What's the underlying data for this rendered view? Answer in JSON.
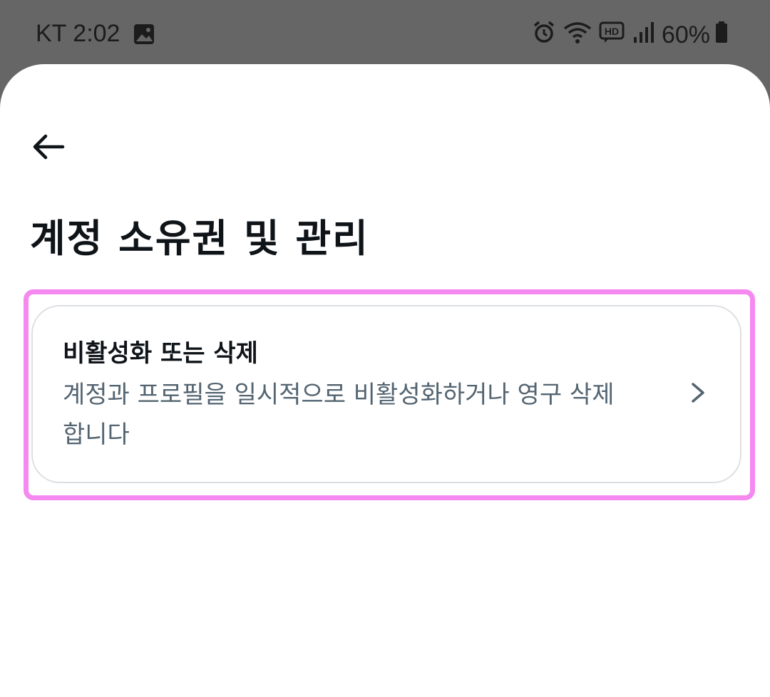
{
  "status_bar": {
    "carrier_time": "KT 2:02",
    "battery": "60%",
    "icons": [
      "gallery-icon",
      "alarm-icon",
      "wifi-icon",
      "hd-voice-icon",
      "signal-icon",
      "battery-icon"
    ]
  },
  "header": {
    "back_icon": "arrow-left-icon",
    "title": "계정 소유권 및 관리"
  },
  "card": {
    "title": "비활성화 또는 삭제",
    "description": "계정과 프로필을 일시적으로 비활성화하거나 영구 삭제합니다",
    "chevron_icon": "chevron-right-icon"
  },
  "colors": {
    "highlight": "#f589f0",
    "text_primary": "#0f1419",
    "text_secondary": "#536471",
    "status_bg": "#666666"
  }
}
